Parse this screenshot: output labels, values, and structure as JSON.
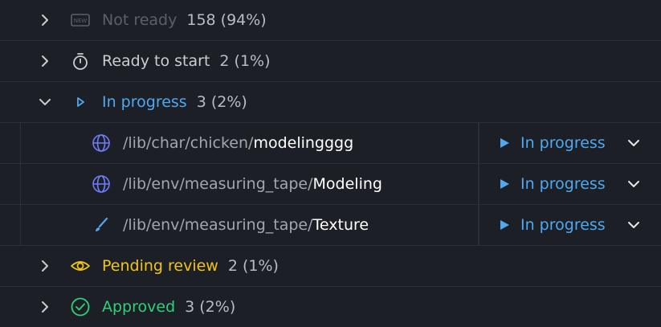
{
  "colors": {
    "background": "#1c2026",
    "divider": "#2b3038",
    "not_ready": "#5b6068",
    "default": "#c9ccd1",
    "in_progress": "#4fa8f0",
    "pending": "#f2c418",
    "approved": "#2fd07a"
  },
  "groups": [
    {
      "label": "Not ready",
      "count": "158 (94%)",
      "icon": "new-badge-icon",
      "expanded": false
    },
    {
      "label": "Ready to start",
      "count": "2 (1%)",
      "icon": "stopwatch-icon",
      "expanded": false
    },
    {
      "label": "In progress",
      "count": "3 (2%)",
      "icon": "play-outline-icon",
      "expanded": true
    },
    {
      "label": "Pending review",
      "count": "2 (1%)",
      "icon": "eye-icon",
      "expanded": false
    },
    {
      "label": "Approved",
      "count": "3 (2%)",
      "icon": "check-circle-icon",
      "expanded": false
    }
  ],
  "tasks": [
    {
      "dir": "/lib/char/chicken/",
      "name": "modelingggg",
      "icon": "globe-icon",
      "status": "In progress"
    },
    {
      "dir": "/lib/env/measuring_tape/",
      "name": "Modeling",
      "icon": "globe-icon",
      "status": "In progress"
    },
    {
      "dir": "/lib/env/measuring_tape/",
      "name": "Texture",
      "icon": "brush-icon",
      "status": "In progress"
    }
  ]
}
